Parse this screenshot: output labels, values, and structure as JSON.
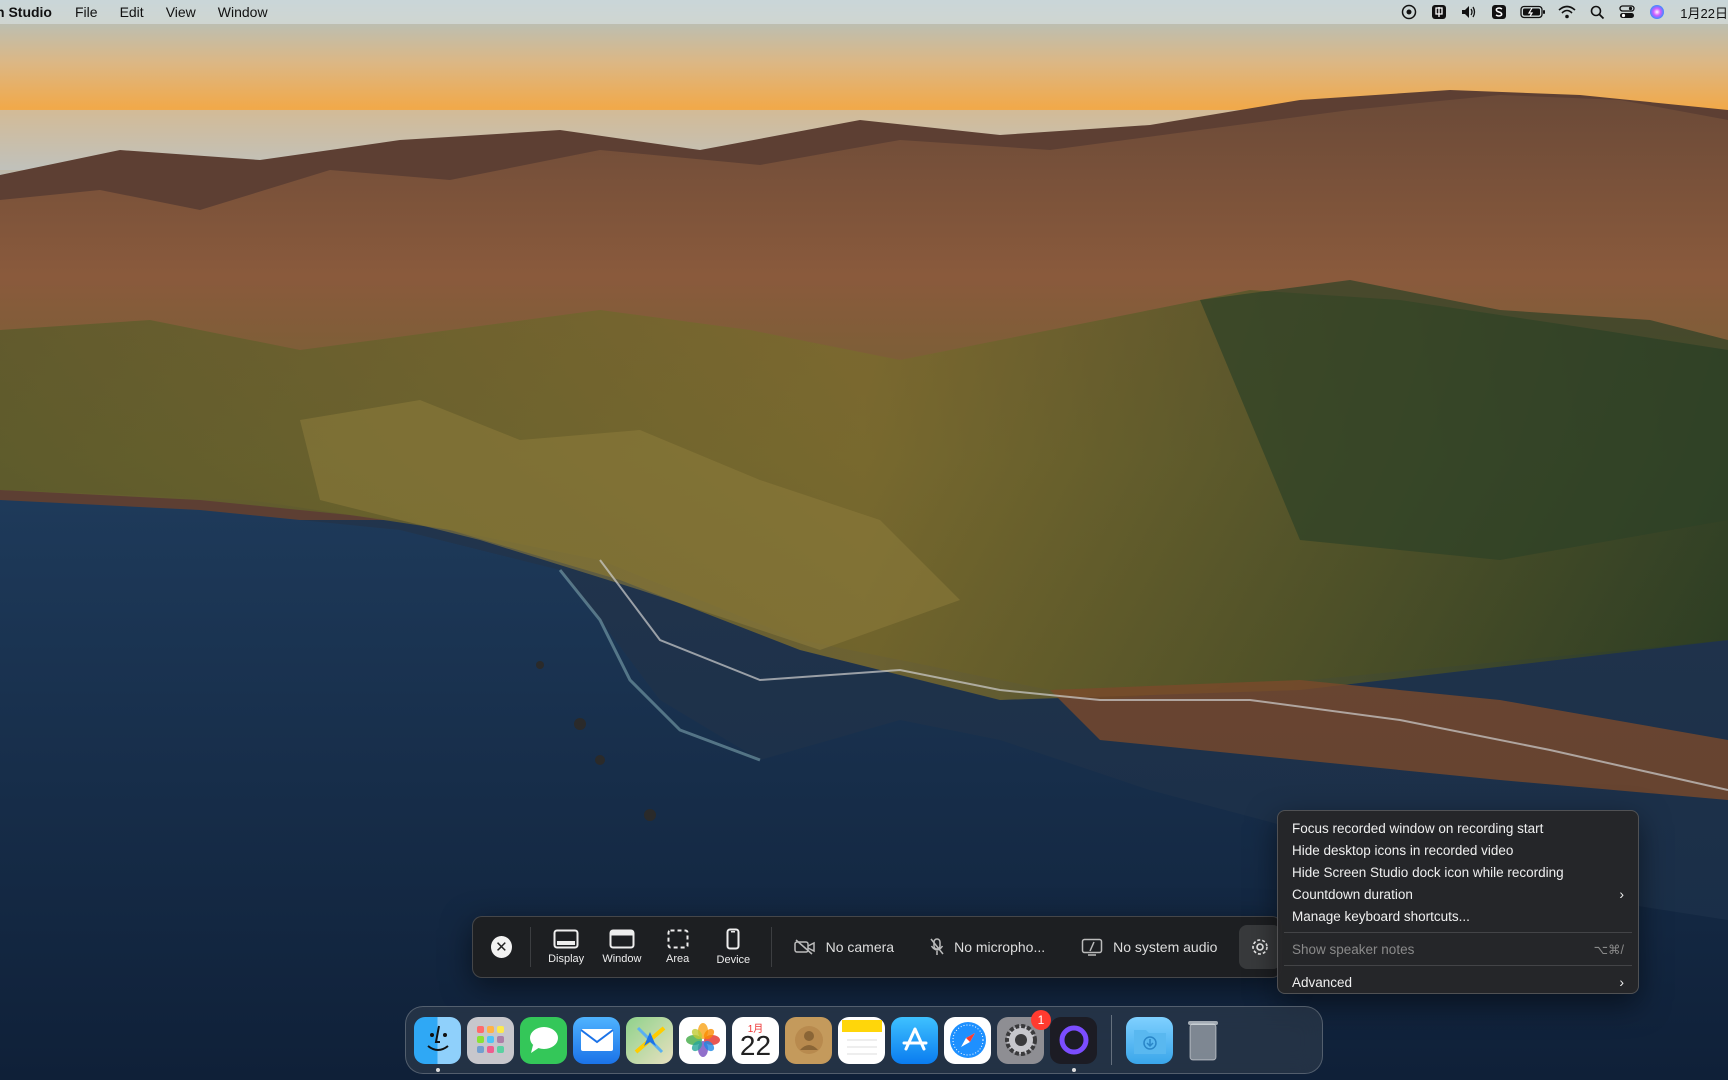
{
  "menubar": {
    "app_name": "n Studio",
    "menus": [
      "File",
      "Edit",
      "View",
      "Window"
    ],
    "status_icons": [
      "screen-record-icon",
      "input-method-icon",
      "volume-icon",
      "app-s-icon",
      "battery-icon",
      "wifi-icon",
      "spotlight-search-icon",
      "control-center-icon",
      "siri-icon"
    ],
    "clock": "1月22日"
  },
  "toolbar": {
    "close_label": "✕",
    "modes": [
      {
        "label": "Display",
        "icon": "display-icon"
      },
      {
        "label": "Window",
        "icon": "window-icon"
      },
      {
        "label": "Area",
        "icon": "area-icon"
      },
      {
        "label": "Device",
        "icon": "device-icon"
      }
    ],
    "camera_label": "No camera",
    "microphone_label": "No micropho...",
    "system_audio_label": "No system audio"
  },
  "context_menu": {
    "items": [
      {
        "label": "Focus recorded window on recording start"
      },
      {
        "label": "Hide desktop icons in recorded video"
      },
      {
        "label": "Hide Screen Studio dock icon while recording"
      },
      {
        "label": "Countdown duration",
        "submenu": "›"
      },
      {
        "label": "Manage keyboard shortcuts..."
      }
    ],
    "disabled_item": {
      "label": "Show speaker notes",
      "shortcut": "⌥⌘/"
    },
    "advanced_item": {
      "label": "Advanced",
      "submenu": "›"
    }
  },
  "dock": {
    "apps": [
      "finder",
      "launchpad",
      "messages",
      "mail",
      "maps",
      "photos",
      "calendar",
      "contacts",
      "notes",
      "app-store",
      "safari",
      "system-settings",
      "screen-studio"
    ],
    "calendar": {
      "month": "1月",
      "day": "22"
    },
    "settings_badge": "1"
  },
  "colors": {
    "accent_red": "#ff3b30",
    "menu_bg": "#262628",
    "toolbar_bg": "#1e1e20"
  }
}
